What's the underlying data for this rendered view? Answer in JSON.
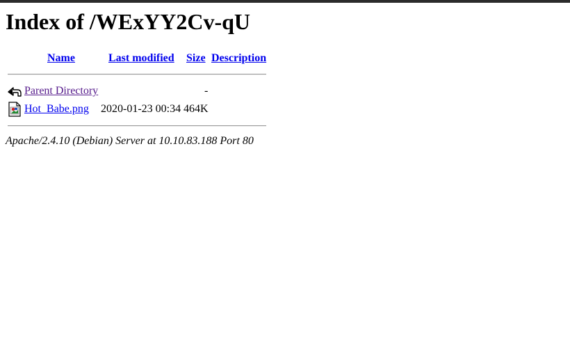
{
  "title": "Index of /WExYY2Cv-qU",
  "columns": {
    "name": "Name",
    "last_modified": "Last modified",
    "size": "Size",
    "description": "Description"
  },
  "rows": [
    {
      "icon": "back-arrow-icon",
      "name": "Parent Directory",
      "last_modified": "",
      "size": "-",
      "description": ""
    },
    {
      "icon": "image-file-icon",
      "name": "Hot_Babe.png",
      "last_modified": "2020-01-23 00:34",
      "size": "464K",
      "description": ""
    }
  ],
  "footer": "Apache/2.4.10 (Debian) Server at 10.10.83.188 Port 80",
  "colors": {
    "link": "#0000ee",
    "visited_link": "#551a8b",
    "top_bar": "#2b2b2b"
  }
}
